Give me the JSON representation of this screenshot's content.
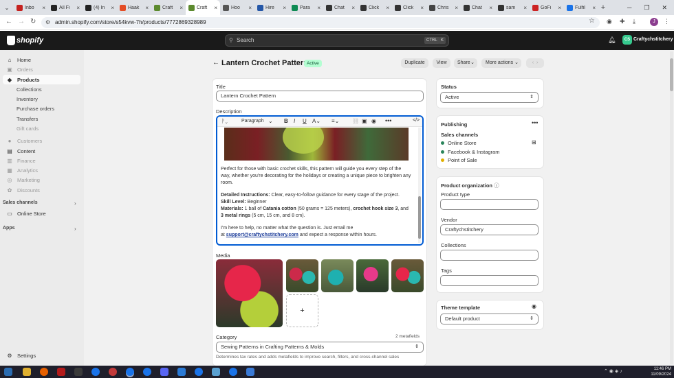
{
  "browser": {
    "tabs": [
      {
        "title": "Inbo",
        "color": "#c5221f",
        "active": false
      },
      {
        "title": "All Fi",
        "color": "#222",
        "active": false
      },
      {
        "title": "(4) In",
        "color": "#222",
        "active": false
      },
      {
        "title": "Haak",
        "color": "#e44d26",
        "active": false
      },
      {
        "title": "Craft",
        "color": "#5c8a2e",
        "active": false
      },
      {
        "title": "Craft",
        "color": "#5c8a2e",
        "active": true
      },
      {
        "title": "Hoo",
        "color": "#555",
        "active": false
      },
      {
        "title": "Hire",
        "color": "#2557a7",
        "active": false
      },
      {
        "title": "Para",
        "color": "#0d8a53",
        "active": false
      },
      {
        "title": "Chat",
        "color": "#333",
        "active": false
      },
      {
        "title": "Click",
        "color": "#333",
        "active": false
      },
      {
        "title": "Click",
        "color": "#333",
        "active": false
      },
      {
        "title": "Chris",
        "color": "#444",
        "active": false
      },
      {
        "title": "Chat",
        "color": "#333",
        "active": false
      },
      {
        "title": "sam",
        "color": "#333",
        "active": false
      },
      {
        "title": "GoFi",
        "color": "#c22",
        "active": false
      },
      {
        "title": "Fulfil",
        "color": "#1a73e8",
        "active": false
      }
    ],
    "url": "admin.shopify.com/store/s54kvw-7h/products/7772869328989"
  },
  "topbar": {
    "logo": "shopify",
    "search_placeholder": "Search",
    "kbd1": "CTRL",
    "kbd2": "K",
    "store_initials": "CS",
    "store_name": "Craftychstitchery"
  },
  "sidebar": {
    "items": [
      {
        "label": "Home",
        "icon": "⌂",
        "cls": ""
      },
      {
        "label": "Orders",
        "icon": "▣",
        "cls": "dim"
      },
      {
        "label": "Products",
        "icon": "◆",
        "cls": "sel"
      },
      {
        "label": "Collections",
        "icon": "",
        "cls": "sub"
      },
      {
        "label": "Inventory",
        "icon": "",
        "cls": "sub"
      },
      {
        "label": "Purchase orders",
        "icon": "",
        "cls": "sub"
      },
      {
        "label": "Transfers",
        "icon": "",
        "cls": "sub"
      },
      {
        "label": "Gift cards",
        "icon": "",
        "cls": "sub dim"
      },
      {
        "label": "Customers",
        "icon": "●",
        "cls": "dim"
      },
      {
        "label": "Content",
        "icon": "▤",
        "cls": ""
      },
      {
        "label": "Finance",
        "icon": "▥",
        "cls": "dim"
      },
      {
        "label": "Analytics",
        "icon": "▦",
        "cls": "dim"
      },
      {
        "label": "Marketing",
        "icon": "◎",
        "cls": "dim"
      },
      {
        "label": "Discounts",
        "icon": "✿",
        "cls": "dim"
      }
    ],
    "sales_channels_label": "Sales channels",
    "online_store": "Online Store",
    "apps_label": "Apps",
    "settings": "Settings"
  },
  "page": {
    "title": "Lantern Crochet Pattern",
    "badge": "Active",
    "duplicate": "Duplicate",
    "view": "View",
    "share": "Share",
    "more_actions": "More actions"
  },
  "product": {
    "title_label": "Title",
    "title_value": "Lantern Crochet Pattern",
    "description_label": "Description",
    "paragraph_select": "Paragraph",
    "desc": {
      "p1": "Perfect for those with basic crochet skills, this pattern will guide you every step of the way, whether you're decorating for the holidays or creating a unique piece to brighten any room.",
      "l1_b": "Detailed Instructions:",
      "l1_t": " Clear, easy-to-follow guidance for every stage of the project.",
      "l2_b": "Skill Level:",
      "l2_t": " Beginner",
      "l3_b": "Materials:",
      "l3_t1": " 1 ball of ",
      "l3_b2": "Catania cotton",
      "l3_t2": " (50 grams = 125 meters), ",
      "l3_b3": "crochet hook size 3",
      "l3_t3": ", and ",
      "l3_b4": "3 metal rings",
      "l3_t4": " (5 cm, 15 cm, and 8 cm).",
      "p3a": "I'm here to help, no matter what the question is. Just email me",
      "p3b": "at ",
      "email": "support@craftychstitchery.com",
      "p3c": " and expect a response within hours."
    },
    "media_label": "Media",
    "category_label": "Category",
    "metafields": "2 metafields",
    "category_value": "Sewing Patterns in Crafting Patterns & Molds",
    "category_help": "Determines tax rates and adds metafields to improve search, filters, and cross-channel sales"
  },
  "status": {
    "label": "Status",
    "value": "Active"
  },
  "publishing": {
    "label": "Publishing",
    "channels_label": "Sales channels",
    "channels": [
      {
        "name": "Online Store",
        "color": "#29845a"
      },
      {
        "name": "Facebook & Instagram",
        "color": "#29845a"
      },
      {
        "name": "Point of Sale",
        "color": "#e0b000"
      }
    ]
  },
  "organization": {
    "label": "Product organization",
    "type_label": "Product type",
    "type_value": "",
    "vendor_label": "Vendor",
    "vendor_value": "Craftychstitchery",
    "collections_label": "Collections",
    "collections_value": "",
    "tags_label": "Tags",
    "tags_value": ""
  },
  "theme": {
    "label": "Theme template",
    "value": "Default product"
  },
  "clock": {
    "time": "11:46 PM",
    "date": "11/09/2024"
  }
}
